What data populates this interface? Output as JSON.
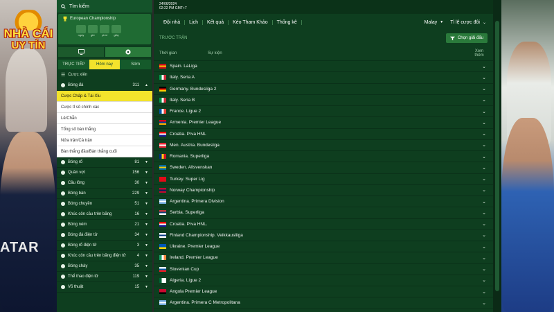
{
  "logo": {
    "line1": "NHÀ CÁI",
    "line2": "UY TÍN"
  },
  "left_photo_text": "ATAR",
  "sidebar": {
    "search_label": "Tìm kiếm",
    "promo_title": "European Championship",
    "countdown": [
      {
        "value": "",
        "label": "ngày"
      },
      {
        "value": "",
        "label": "giờ"
      },
      {
        "value": "",
        "label": "phút"
      },
      {
        "value": "",
        "label": "giây"
      }
    ],
    "tabs": [
      "TRỰC TIẾP",
      "Hôm nay",
      "Sớm"
    ],
    "sports_header": "Cược xiên",
    "top_sport": {
      "name": "Bóng đá",
      "count": "311"
    },
    "sub_items": [
      "Cược Chấp & Tài Xỉu",
      "Cược tỉ số chính xác",
      "Lẻ/Chẵn",
      "Tổng số bàn thắng",
      "Nửa trận/Cả trận",
      "Bàn thắng đầu/Bàn thắng cuối"
    ],
    "sports": [
      {
        "name": "Bóng rổ",
        "count": "81"
      },
      {
        "name": "Quần vợt",
        "count": "156"
      },
      {
        "name": "Cầu lông",
        "count": "30"
      },
      {
        "name": "Bóng bàn",
        "count": "229"
      },
      {
        "name": "Bóng chuyền",
        "count": "51"
      },
      {
        "name": "Khúc côn cầu trên băng",
        "count": "16"
      },
      {
        "name": "Bóng ném",
        "count": "21"
      },
      {
        "name": "Bóng đá điện tử",
        "count": "34"
      },
      {
        "name": "Bóng rổ điện tử",
        "count": "3"
      },
      {
        "name": "Khúc côn cầu trên băng điện tử",
        "count": "4"
      },
      {
        "name": "Bóng chày",
        "count": "35"
      },
      {
        "name": "Thể thao điện tử",
        "count": "119"
      },
      {
        "name": "Võ thuật",
        "count": "15"
      }
    ]
  },
  "main": {
    "date": "24/06/2024",
    "time": "02:22 PM GMT+7",
    "nav": [
      "Đội nhà",
      "Lịch",
      "Kết quả",
      "Kèo Tham Khảo",
      "Thống kê"
    ],
    "odds_region": "Malay",
    "odds_type": "Tỉ lệ cược đôi",
    "section_title": "TRƯỚC TRẬN",
    "choose_league": "Chọn giải đấu",
    "columns": {
      "time": "Thời gian",
      "event": "Sự kiện",
      "more": "Xem thêm"
    },
    "leagues": [
      {
        "name": "Spain. LaLiga",
        "flag": [
          "#c60b1e",
          "#ffc400",
          "#c60b1e"
        ],
        "dir": "h"
      },
      {
        "name": "Italy. Seria A",
        "flag": [
          "#009246",
          "#ffffff",
          "#ce2b37"
        ],
        "dir": "v"
      },
      {
        "name": "Germany. Bundesliga 2",
        "flag": [
          "#000000",
          "#dd0000",
          "#ffce00"
        ],
        "dir": "h"
      },
      {
        "name": "Italy. Seria B",
        "flag": [
          "#009246",
          "#ffffff",
          "#ce2b37"
        ],
        "dir": "v"
      },
      {
        "name": "France. Ligue 2",
        "flag": [
          "#0055a4",
          "#ffffff",
          "#ef4135"
        ],
        "dir": "v"
      },
      {
        "name": "Armenia. Premier League",
        "flag": [
          "#d90012",
          "#0033a0",
          "#f2a800"
        ],
        "dir": "h"
      },
      {
        "name": "Croatia. Prva HNL",
        "flag": [
          "#ff0000",
          "#ffffff",
          "#171796"
        ],
        "dir": "h"
      },
      {
        "name": "Men. Austria. Bundesliga",
        "flag": [
          "#ed2939",
          "#ffffff",
          "#ed2939"
        ],
        "dir": "h"
      },
      {
        "name": "Romania. Superliga",
        "flag": [
          "#002b7f",
          "#fcd116",
          "#ce1126"
        ],
        "dir": "v"
      },
      {
        "name": "Sweden. Allsvenskan",
        "flag": [
          "#006aa7",
          "#fecc00",
          "#006aa7"
        ],
        "dir": "h"
      },
      {
        "name": "Turkey. Super Lig",
        "flag": [
          "#e30a17",
          "#e30a17",
          "#e30a17"
        ],
        "dir": "h"
      },
      {
        "name": "Norway Championship",
        "flag": [
          "#ba0c2f",
          "#00205b",
          "#ba0c2f"
        ],
        "dir": "h"
      },
      {
        "name": "Argentina. Primera Division",
        "flag": [
          "#74acdf",
          "#ffffff",
          "#74acdf"
        ],
        "dir": "h"
      },
      {
        "name": "Serbia. Superliga",
        "flag": [
          "#c6363c",
          "#0c4076",
          "#ffffff"
        ],
        "dir": "h"
      },
      {
        "name": "Croatia. Prva HNL.",
        "flag": [
          "#ff0000",
          "#ffffff",
          "#171796"
        ],
        "dir": "h"
      },
      {
        "name": "Finland Championship. Veikkausliiga",
        "flag": [
          "#ffffff",
          "#003580",
          "#ffffff"
        ],
        "dir": "h"
      },
      {
        "name": "Ukraine. Premier League",
        "flag": [
          "#0057b7",
          "#0057b7",
          "#ffd700"
        ],
        "dir": "h"
      },
      {
        "name": "Ireland. Premier League",
        "flag": [
          "#169b62",
          "#ffffff",
          "#ff883e"
        ],
        "dir": "v"
      },
      {
        "name": "Slovenian Cup",
        "flag": [
          "#ffffff",
          "#005da4",
          "#ed1c24"
        ],
        "dir": "h"
      },
      {
        "name": "Algeria. Ligue 2",
        "flag": [
          "#006233",
          "#ffffff",
          "#ffffff"
        ],
        "dir": "v"
      },
      {
        "name": "Angola Premier League",
        "flag": [
          "#cc092f",
          "#cc092f",
          "#000000"
        ],
        "dir": "h"
      },
      {
        "name": "Argentina. Primera C Metropolitana",
        "flag": [
          "#74acdf",
          "#ffffff",
          "#74acdf"
        ],
        "dir": "h"
      }
    ]
  }
}
